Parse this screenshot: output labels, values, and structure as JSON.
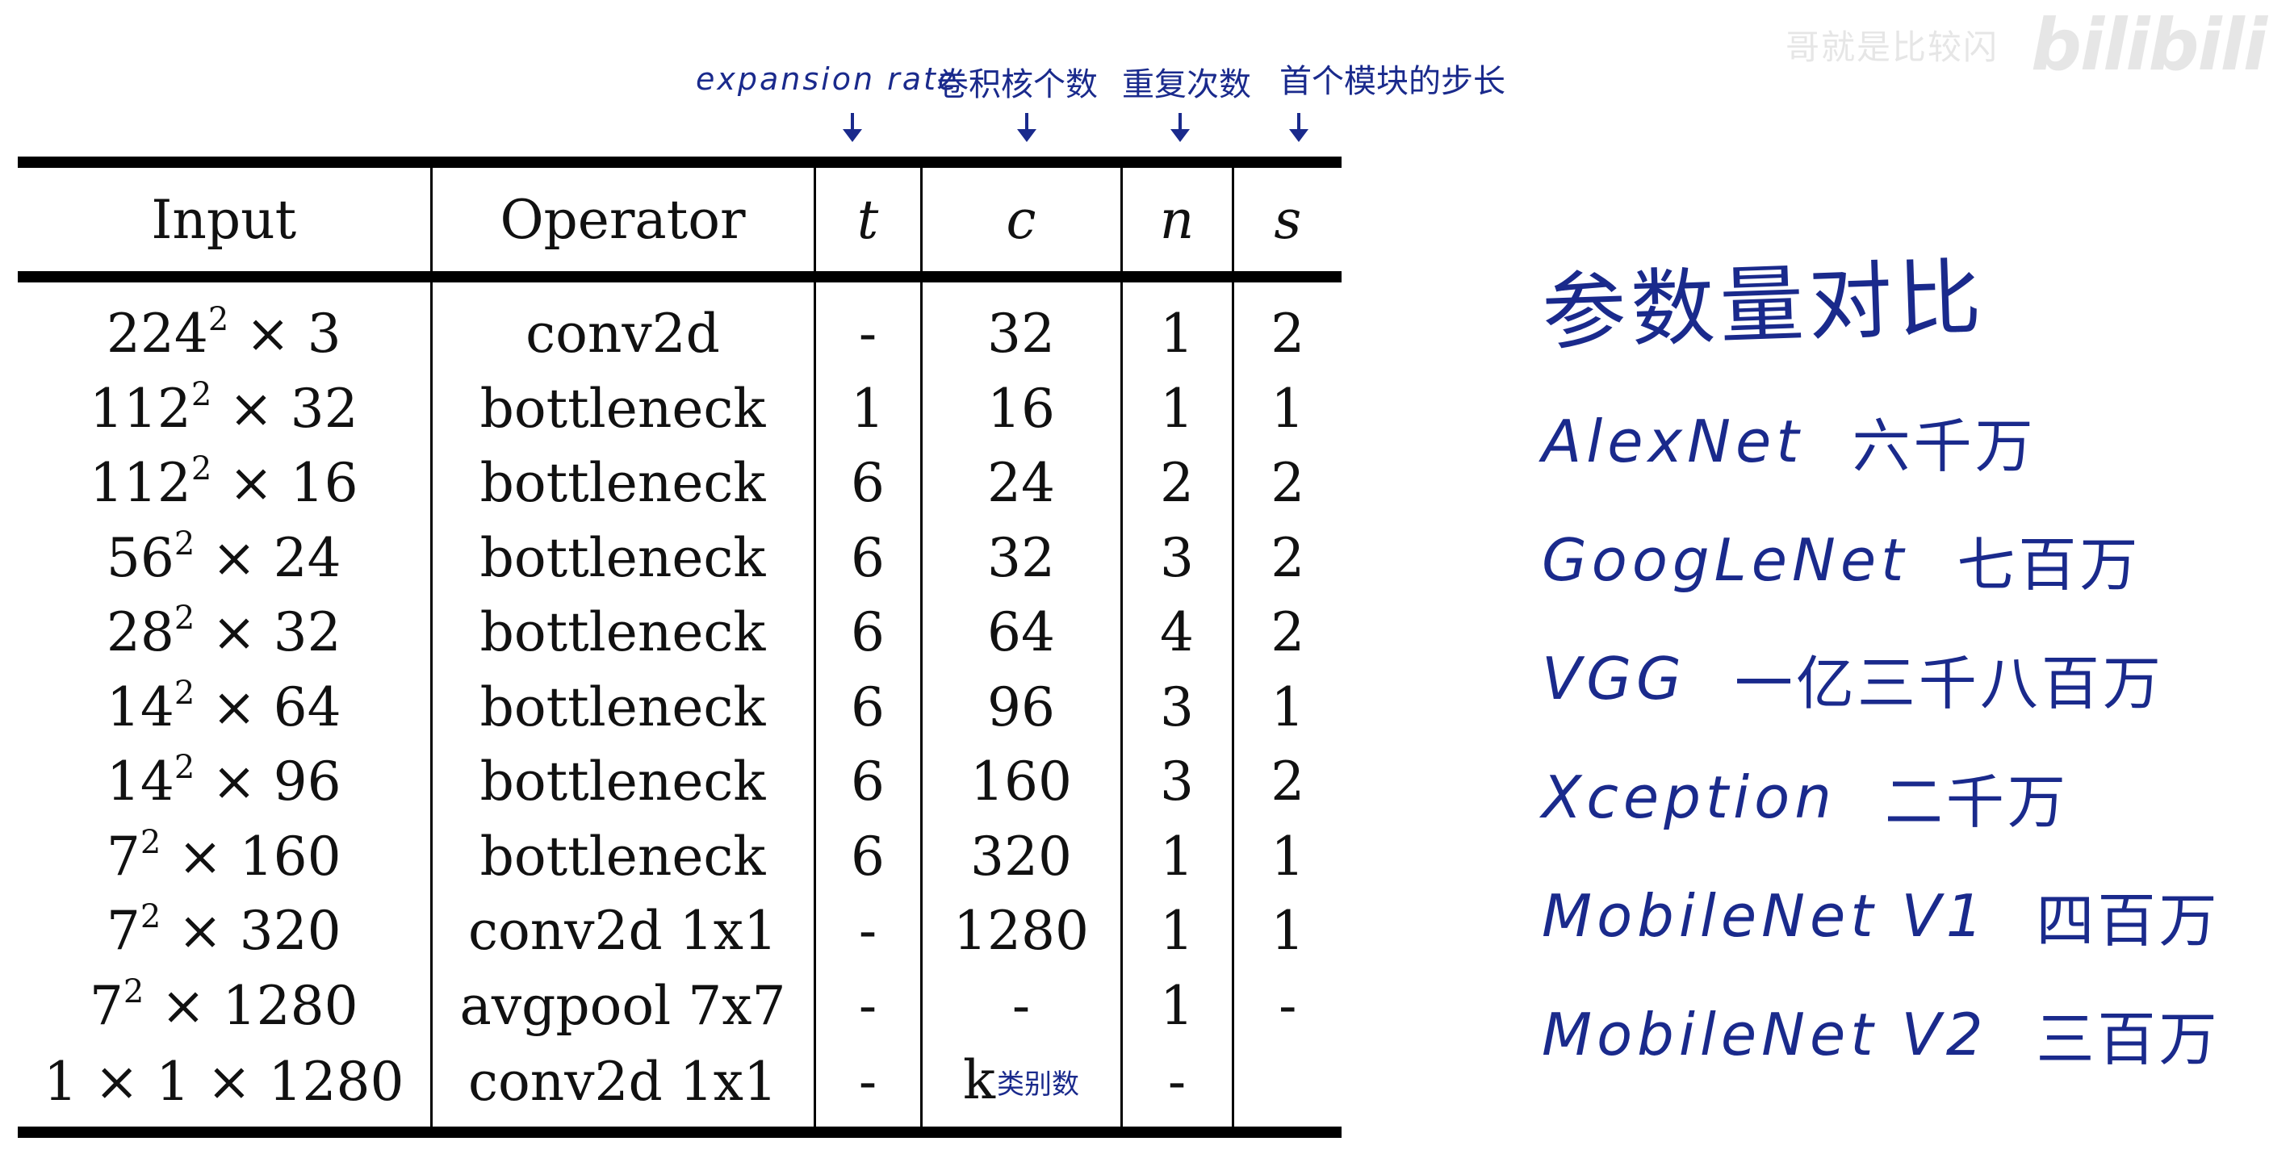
{
  "watermark": {
    "text": "哥就是比较闪",
    "logo": "bilibili"
  },
  "annotations": {
    "t": "expansion rate",
    "c": "卷积核个数",
    "n": "重复次数",
    "s": "首个模块的步长"
  },
  "table": {
    "headers": [
      "Input",
      "Operator",
      "t",
      "c",
      "n",
      "s"
    ],
    "rows": [
      {
        "input_base": "224",
        "input_exp": "2",
        "input_rest": " × 3",
        "operator": "conv2d",
        "t": "-",
        "c": "32",
        "n": "1",
        "s": "2"
      },
      {
        "input_base": "112",
        "input_exp": "2",
        "input_rest": " × 32",
        "operator": "bottleneck",
        "t": "1",
        "c": "16",
        "n": "1",
        "s": "1"
      },
      {
        "input_base": "112",
        "input_exp": "2",
        "input_rest": " × 16",
        "operator": "bottleneck",
        "t": "6",
        "c": "24",
        "n": "2",
        "s": "2"
      },
      {
        "input_base": "56",
        "input_exp": "2",
        "input_rest": " × 24",
        "operator": "bottleneck",
        "t": "6",
        "c": "32",
        "n": "3",
        "s": "2"
      },
      {
        "input_base": "28",
        "input_exp": "2",
        "input_rest": " × 32",
        "operator": "bottleneck",
        "t": "6",
        "c": "64",
        "n": "4",
        "s": "2"
      },
      {
        "input_base": "14",
        "input_exp": "2",
        "input_rest": " × 64",
        "operator": "bottleneck",
        "t": "6",
        "c": "96",
        "n": "3",
        "s": "1"
      },
      {
        "input_base": "14",
        "input_exp": "2",
        "input_rest": " × 96",
        "operator": "bottleneck",
        "t": "6",
        "c": "160",
        "n": "3",
        "s": "2"
      },
      {
        "input_base": "7",
        "input_exp": "2",
        "input_rest": " × 160",
        "operator": "bottleneck",
        "t": "6",
        "c": "320",
        "n": "1",
        "s": "1"
      },
      {
        "input_base": "7",
        "input_exp": "2",
        "input_rest": " × 320",
        "operator": "conv2d 1x1",
        "t": "-",
        "c": "1280",
        "n": "1",
        "s": "1"
      },
      {
        "input_base": "7",
        "input_exp": "2",
        "input_rest": " × 1280",
        "operator": "avgpool 7x7",
        "t": "-",
        "c": "-",
        "n": "1",
        "s": "-"
      },
      {
        "input_base": "1 × 1 × 1280",
        "input_exp": "",
        "input_rest": "",
        "operator": "conv2d 1x1",
        "t": "-",
        "c": "k",
        "c_note": "类别数",
        "n": "-",
        "s": ""
      }
    ]
  },
  "comparison": {
    "title": "参数量对比",
    "items": [
      {
        "name": "AlexNet",
        "value": "六千万"
      },
      {
        "name": "GoogLeNet",
        "value": "七百万"
      },
      {
        "name": "VGG",
        "value": "一亿三千八百万"
      },
      {
        "name": "Xception",
        "value": "二千万"
      },
      {
        "name": "MobileNet V1",
        "value": "四百万"
      },
      {
        "name": "MobileNet V2",
        "value": "三百万"
      }
    ]
  },
  "colors": {
    "ink": "#1a2a8c",
    "text": "#111111"
  }
}
